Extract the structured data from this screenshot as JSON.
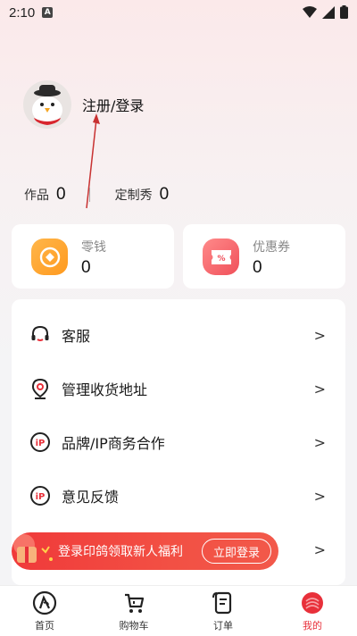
{
  "status_bar": {
    "time": "2:10",
    "notif": "A"
  },
  "profile": {
    "login_label": "注册/登录"
  },
  "counts": [
    {
      "label": "作品",
      "value": "0"
    },
    {
      "label": "定制秀",
      "value": "0"
    }
  ],
  "wallet": {
    "label": "零钱",
    "value": "0"
  },
  "coupon": {
    "label": "优惠券",
    "value": "0"
  },
  "menu": {
    "items": [
      {
        "label": "客服"
      },
      {
        "label": "管理收货地址"
      },
      {
        "label": "品牌/IP商务合作"
      },
      {
        "label": "意见反馈"
      }
    ],
    "chevron": ">"
  },
  "promo": {
    "text": "登录印鸽领取新人福利",
    "button": "立即登录"
  },
  "tabbar": {
    "tabs": [
      {
        "label": "首页",
        "icon": "home-icon"
      },
      {
        "label": "购物车",
        "icon": "cart-icon"
      },
      {
        "label": "订单",
        "icon": "order-icon"
      },
      {
        "label": "我的",
        "icon": "mine-icon"
      }
    ],
    "active_color": "#e8303a"
  },
  "colors": {
    "accent": "#e8303a",
    "wallet": "#ff9a1f",
    "coupon": "#f0505a"
  }
}
